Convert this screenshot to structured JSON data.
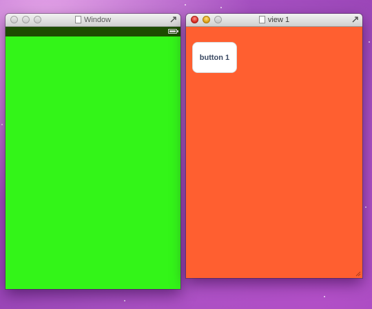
{
  "windows": [
    {
      "title": "Window",
      "controls": [
        "close-icon",
        "minimize-icon",
        "zoom-icon"
      ],
      "statusbar": {
        "icon": "battery-icon",
        "color": "#1d4c00"
      },
      "content_color": "#33f518"
    },
    {
      "title": "view 1",
      "controls": [
        "close-icon",
        "minimize-icon",
        "zoom-icon"
      ],
      "content_color": "#ff5f30",
      "button": {
        "label": "button 1"
      }
    }
  ],
  "colors": {
    "desktop": "#9b46b8",
    "traffic_red": "#d4251c",
    "traffic_yellow": "#dc9b10"
  }
}
